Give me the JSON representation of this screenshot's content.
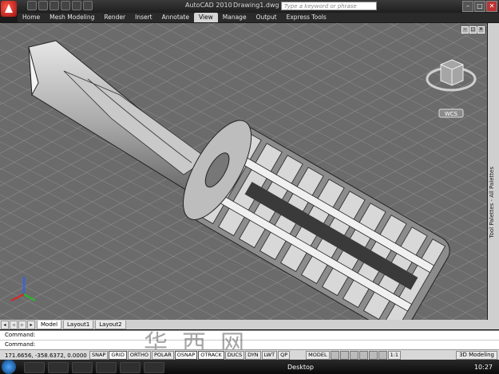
{
  "window": {
    "app_title": "AutoCAD 2010",
    "doc_title": "Drawing1.dwg",
    "search_placeholder": "Type a keyword or phrase"
  },
  "ribbon": {
    "tabs": [
      "Home",
      "Mesh Modeling",
      "Render",
      "Insert",
      "Annotate",
      "View",
      "Manage",
      "Output",
      "Express Tools"
    ],
    "active_tab": "View"
  },
  "viewport": {
    "viewcube_label": "WCS",
    "side_palette_label": "Tool Palettes - All Palettes",
    "background_color": "#6b6b6b"
  },
  "layout_tabs": [
    "Model",
    "Layout1",
    "Layout2"
  ],
  "command_lines": [
    "Command:",
    "Command:"
  ],
  "status": {
    "coordinates": "171.6656, -358.6372, 0.0000",
    "toggles": [
      "SNAP",
      "GRID",
      "ORTHO",
      "POLAR",
      "OSNAP",
      "OTRACK",
      "DUCS",
      "DYN",
      "LWT",
      "QP"
    ],
    "model_button": "MODEL",
    "scale": "1:1",
    "workspace": "3D Modeling"
  },
  "taskbar": {
    "desktop_label": "Desktop",
    "clock": "10:27"
  },
  "watermark": "华西网"
}
